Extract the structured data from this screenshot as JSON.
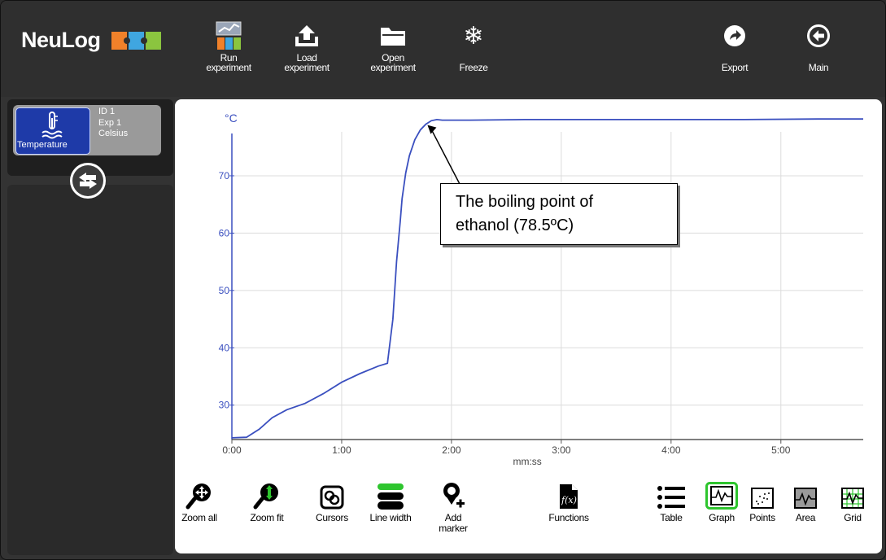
{
  "app": {
    "logo": "NeuLog"
  },
  "toolbar": {
    "run": "Run\nexperiment",
    "load": "Load\nexperiment",
    "open": "Open\nexperiment",
    "freeze": "Freeze",
    "export": "Export",
    "main": "Main"
  },
  "sensor": {
    "label": "Temperature",
    "id": "ID 1",
    "exp": "Exp 1",
    "unit": "Celsius"
  },
  "annotation": {
    "line1": "The boiling point of",
    "line2": "ethanol (78.5ºC)"
  },
  "bottom": {
    "zoom_all": "Zoom all",
    "zoom_fit": "Zoom fit",
    "cursors": "Cursors",
    "line_width": "Line width",
    "add_marker": "Add\nmarker",
    "functions": "Functions",
    "table": "Table",
    "graph": "Graph",
    "points": "Points",
    "area": "Area",
    "grid": "Grid"
  },
  "colors": {
    "line": "#3a4fbf",
    "axis": "#3a4fbf",
    "sensor_blue": "#1e3aa8"
  },
  "chart_data": {
    "type": "line",
    "ylabel": "°C",
    "xlabel": "mm:ss",
    "x_ticks": [
      "0:00",
      "1:00",
      "2:00",
      "3:00",
      "4:00",
      "5:00"
    ],
    "y_ticks": [
      "30",
      "40",
      "50",
      "60",
      "70"
    ],
    "xlim": [
      0,
      345
    ],
    "ylim": [
      24,
      80.5
    ],
    "grid": true,
    "series": [
      {
        "x": [
          0,
          8,
          15,
          22,
          30,
          40,
          50,
          60,
          70,
          80,
          85,
          88,
          90,
          92,
          93,
          95,
          97,
          100,
          103,
          106,
          109,
          112,
          115,
          120,
          130,
          160,
          200,
          240,
          280,
          320,
          345
        ],
        "values": [
          24.3,
          24.4,
          25.8,
          27.8,
          29.2,
          30.3,
          32.0,
          34.0,
          35.5,
          36.8,
          37.3,
          45.0,
          55.0,
          62.0,
          66.0,
          70.5,
          73.5,
          76.3,
          78.0,
          79.0,
          79.6,
          79.8,
          79.7,
          79.7,
          79.7,
          79.8,
          79.8,
          79.8,
          79.8,
          79.9,
          79.9
        ]
      }
    ]
  }
}
